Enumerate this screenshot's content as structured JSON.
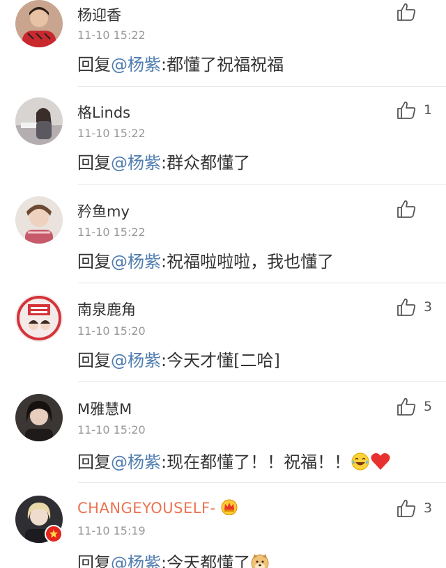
{
  "comments": [
    {
      "user": "杨迎香",
      "time": "11-10 15:22",
      "reply_prefix": "回复",
      "mention": "@杨紫",
      "text": ":都懂了祝福祝福",
      "likes": ""
    },
    {
      "user": "格Linds",
      "time": "11-10 15:22",
      "reply_prefix": "回复",
      "mention": "@杨紫",
      "text": ":群众都懂了",
      "likes": "1"
    },
    {
      "user": "矜鱼my",
      "time": "11-10 15:22",
      "reply_prefix": "回复",
      "mention": "@杨紫",
      "text": ":祝福啦啦啦，我也懂了",
      "likes": ""
    },
    {
      "user": "南泉鹿角",
      "time": "11-10 15:20",
      "reply_prefix": "回复",
      "mention": "@杨紫",
      "text": ":今天才懂[二哈]",
      "likes": "3"
    },
    {
      "user": "M雅慧M",
      "time": "11-10 15:20",
      "reply_prefix": "回复",
      "mention": "@杨紫",
      "text": ":现在都懂了！！祝福！！",
      "likes": "5"
    },
    {
      "user": "CHANGEYOUSELF-",
      "time": "11-10 15:19",
      "reply_prefix": "回复",
      "mention": "@杨紫",
      "text": ":今天都懂了",
      "likes": "3"
    }
  ],
  "icons": {
    "like": "thumbs-up-outline",
    "laugh_emoji": "laughing-crying-face",
    "heart_emoji": "red-heart",
    "doge_emoji": "doge-dog-face",
    "crown_badge": "vip-crown",
    "verified_badge": "red-v-badge"
  },
  "colors": {
    "mention": "#507daf",
    "vip_name": "#eb7350",
    "time": "#999999",
    "heart": "#e8312f"
  }
}
